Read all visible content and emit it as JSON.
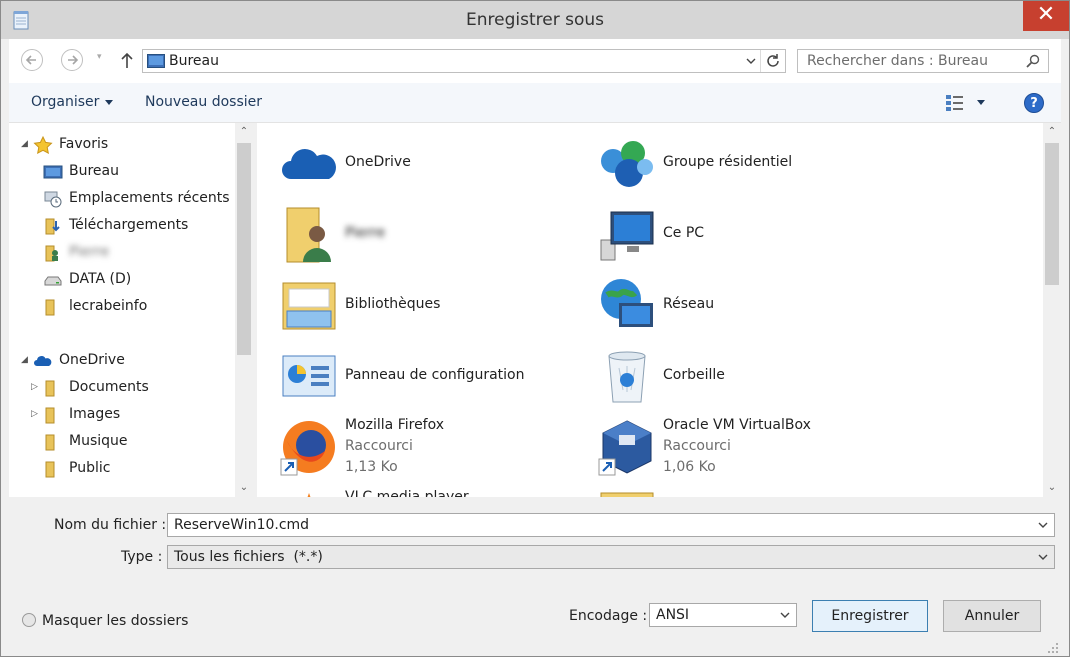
{
  "window": {
    "title": "Enregistrer sous",
    "close_glyph": "✕"
  },
  "nav": {
    "back_icon": "back-arrow-icon",
    "forward_icon": "forward-arrow-icon",
    "history_glyph": "▾",
    "address": "Bureau",
    "search_placeholder": "Rechercher dans : Bureau"
  },
  "toolbar": {
    "organize_label": "Organiser",
    "new_folder_label": "Nouveau dossier",
    "help_glyph": "?"
  },
  "sidebar": {
    "favorites_label": "Favoris",
    "favorites_items": [
      "Bureau",
      "Emplacements récents",
      "Téléchargements",
      "Pierre",
      "DATA (D)",
      "lecrabeinfo"
    ],
    "onedrive_label": "OneDrive",
    "onedrive_items": [
      "Documents",
      "Images",
      "Musique",
      "Public"
    ]
  },
  "content": {
    "items": [
      {
        "name": "OneDrive",
        "icon": "onedrive-cloud-icon"
      },
      {
        "name": "Groupe résidentiel",
        "icon": "homegroup-icon"
      },
      {
        "name": "Pierre",
        "icon": "user-folder-icon",
        "blurred": true
      },
      {
        "name": "Ce PC",
        "icon": "computer-icon"
      },
      {
        "name": "Bibliothèques",
        "icon": "libraries-icon"
      },
      {
        "name": "Réseau",
        "icon": "network-icon"
      },
      {
        "name": "Panneau de configuration",
        "icon": "control-panel-icon"
      },
      {
        "name": "Corbeille",
        "icon": "recycle-bin-icon"
      },
      {
        "name": "Mozilla Firefox",
        "type": "Raccourci",
        "size": "1,13 Ko",
        "icon": "firefox-icon"
      },
      {
        "name": "Oracle VM VirtualBox",
        "type": "Raccourci",
        "size": "1,06 Ko",
        "icon": "virtualbox-icon"
      },
      {
        "name": "VLC media player",
        "icon": "vlc-icon"
      }
    ]
  },
  "form": {
    "filename_label": "Nom du fichier :",
    "filename_value": "ReserveWin10.cmd",
    "type_label": "Type :",
    "type_value": "Tous les fichiers  (*.*)",
    "encoding_label": "Encodage :",
    "encoding_value": "ANSI",
    "save_label": "Enregistrer",
    "cancel_label": "Annuler",
    "hide_folders_label": "Masquer les dossiers"
  },
  "colors": {
    "accent": "#2d6bc8",
    "close": "#c7402f",
    "primary_border": "#3c7fb1"
  }
}
